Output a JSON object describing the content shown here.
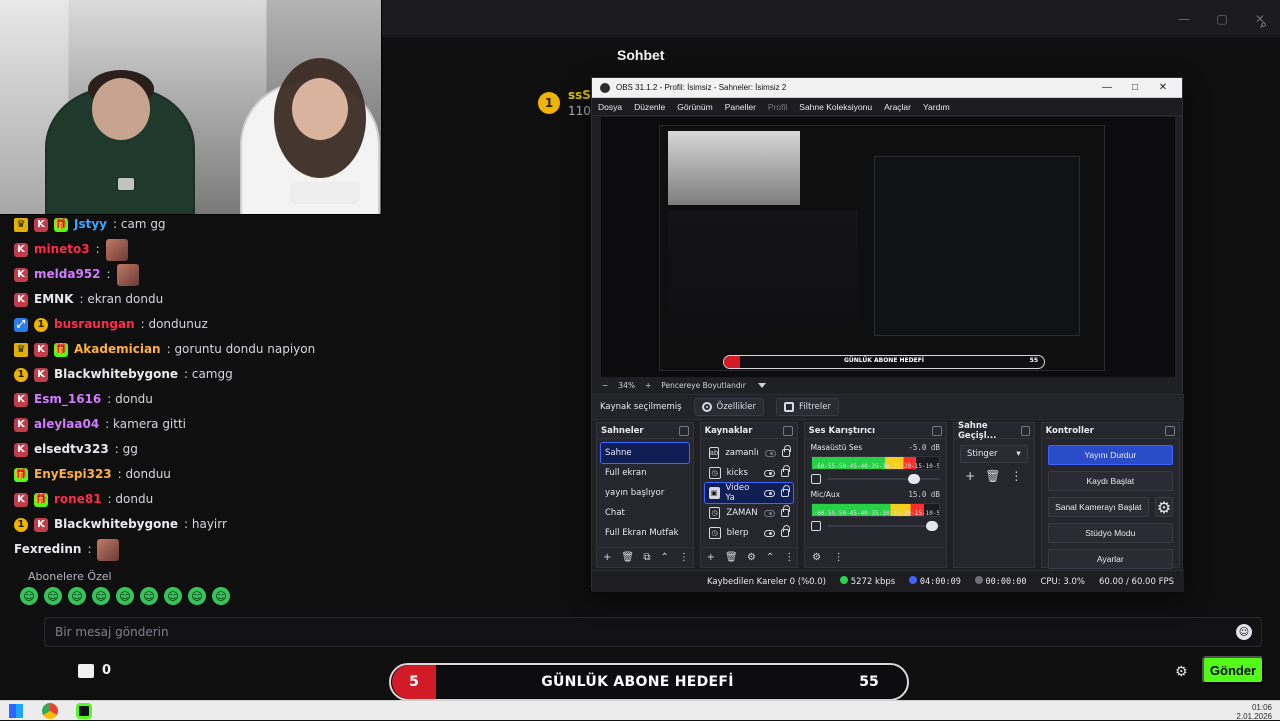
{
  "window": {
    "zoom_icon": "search-plus-icon"
  },
  "chat": {
    "title": "Sohbet",
    "pinned": {
      "coin": "1",
      "name": "ssSi",
      "count": "110"
    },
    "messages": [
      {
        "user": "Jstyy",
        "text": "cam gg",
        "user_color": "#3aa7ff"
      },
      {
        "user": "mineto3",
        "text": "",
        "user_color": "#ff2c4a"
      },
      {
        "user": "melda952",
        "text": "",
        "user_color": "#d37cff"
      },
      {
        "user": "EMNK",
        "text": "ekran dondu",
        "user_color": "#e9e9ef"
      },
      {
        "user": "busraungan",
        "text": "dondunuz",
        "user_color": "#ff2c4a"
      },
      {
        "user": "Akademician",
        "text": "goruntu dondu napiyon",
        "user_color": "#ffb13a"
      },
      {
        "user": "Blackwhitebygone",
        "text": "camgg",
        "user_color": "#e9e9ef"
      },
      {
        "user": "Esm_1616",
        "text": "dondu",
        "user_color": "#d37cff"
      },
      {
        "user": "aleylaa04",
        "text": "kamera gitti",
        "user_color": "#d37cff"
      },
      {
        "user": "elsedtv323",
        "text": "gg",
        "user_color": "#e9e9ef"
      },
      {
        "user": "EnyEspi323",
        "text": "donduu",
        "user_color": "#ffb13a"
      },
      {
        "user": "rone81",
        "text": "dondu",
        "user_color": "#ff2c4a"
      },
      {
        "user": "Blackwhitebygone",
        "text": "hayirr",
        "user_color": "#e9e9ef"
      },
      {
        "user": "Fexredinn",
        "text": "",
        "user_color": "#e9e9ef"
      }
    ],
    "subs_only_label": "Abonelere Özel",
    "input_placeholder": "Bir mesaj gönderin",
    "counter_value": "0",
    "send_label": "Gönder"
  },
  "goal": {
    "left_value": "5",
    "title": "GÜNLÜK ABONE HEDEFİ",
    "right_value": "55"
  },
  "taskbar": {
    "time": "01:06",
    "date": "2.01.2026"
  },
  "obs": {
    "title": "OBS 31.1.2 - Profil: İsimsiz - Sahneler: İsimsiz 2",
    "menu": [
      "Dosya",
      "Düzenle",
      "Görünüm",
      "Paneller",
      "Profil",
      "Sahne Koleksiyonu",
      "Araçlar",
      "Yardım"
    ],
    "zoom": "34%",
    "fit_label": "Pencereye Boyutlandır",
    "no_source": "Kaynak seçilmemiş",
    "properties": "Özellikler",
    "filters": "Filtreler",
    "docks": {
      "scenes_title": "Sahneler",
      "scenes": [
        "Sahne",
        "Full ekran",
        "yayın başlıyor",
        "Chat",
        "Full Ekran Mutfak"
      ],
      "sources_title": "Kaynaklar",
      "sources": [
        "zamanlı",
        "kicks",
        "Video Ya",
        "ZAMAN",
        "blerp"
      ],
      "mixer_title": "Ses Karıştırıcı",
      "mixer": [
        {
          "name": "Masaüstü Ses",
          "db": "-5.0 dB",
          "level": 0.82
        },
        {
          "name": "Mic/Aux",
          "db": "15.0 dB",
          "level": 0.88
        }
      ],
      "transitions_title": "Sahne Geçişl...",
      "transition_value": "Stinger",
      "controls_title": "Kontroller",
      "controls": [
        "Yayını Durdur",
        "Kaydı Başlat",
        "Sanal Kamerayı Başlat",
        "Stüdyo Modu",
        "Ayarlar"
      ]
    },
    "status": {
      "dropped": "Kaybedilen Kareler 0 (%0.0)",
      "bitrate": "5272 kbps",
      "stream_time": "04:00:09",
      "record_time": "00:00:00",
      "cpu": "CPU: 3.0%",
      "fps": "60.00 / 60.00 FPS"
    }
  }
}
